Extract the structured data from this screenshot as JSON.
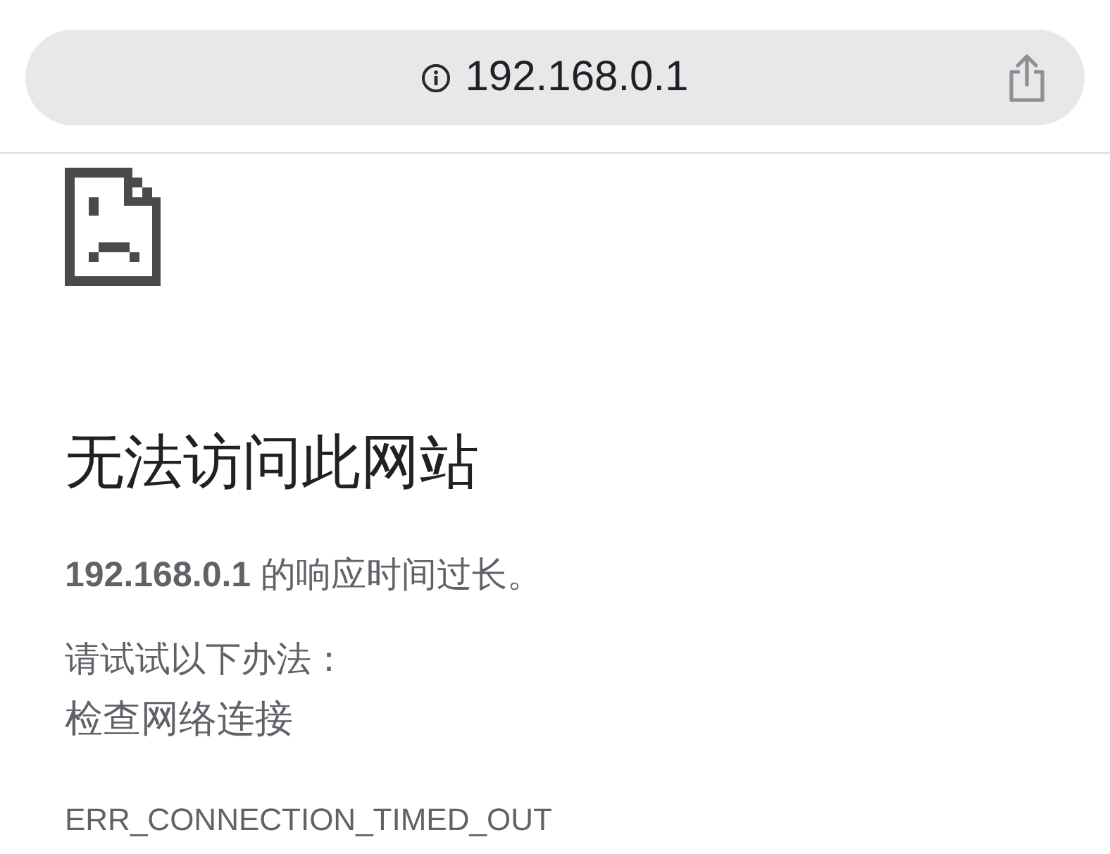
{
  "address_bar": {
    "url": "192.168.0.1"
  },
  "error_page": {
    "title": "无法访问此网站",
    "message": "**192.168.0.1** 的响应时间过长。",
    "suggestions_heading": "请试试以下办法：",
    "suggestions": [
      "检查网络连接"
    ],
    "error_code": "ERR_CONNECTION_TIMED_OUT"
  }
}
